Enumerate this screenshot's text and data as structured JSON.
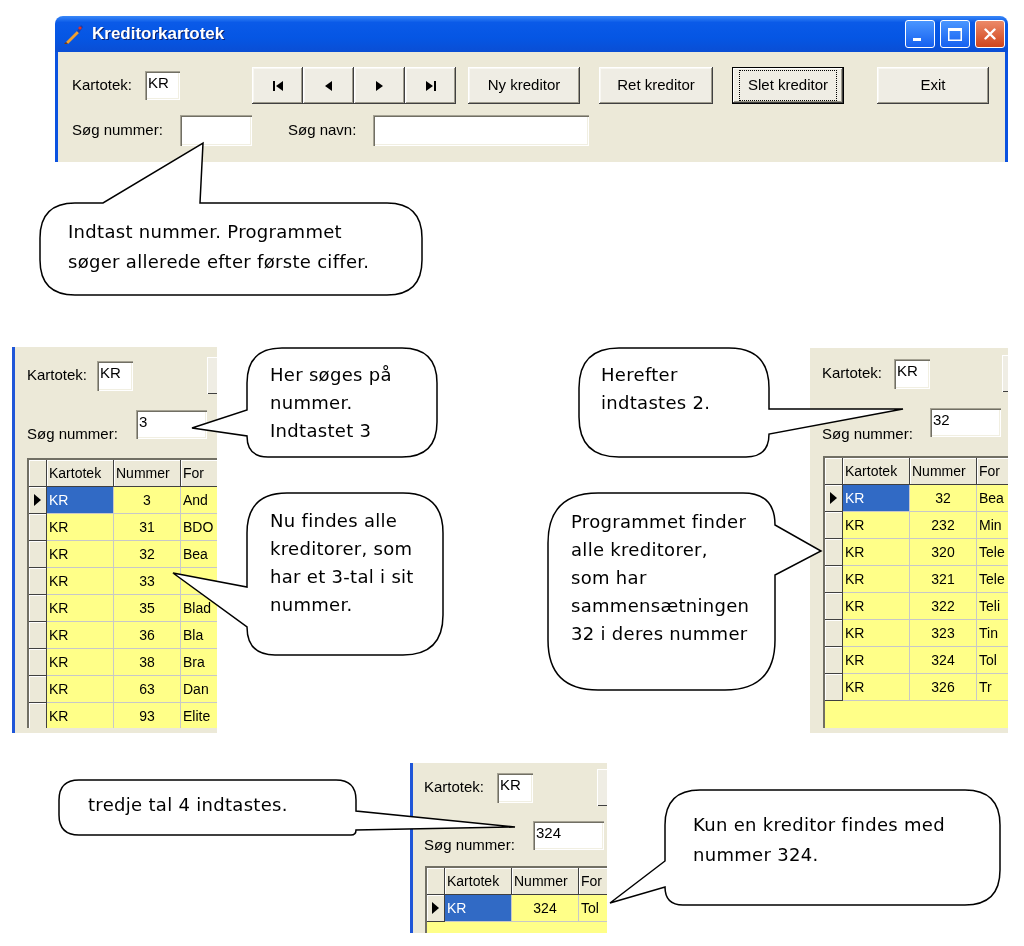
{
  "window": {
    "title": "Kreditorkartotek",
    "kartotek_label": "Kartotek:",
    "kartotek_value": "KR",
    "nav_buttons": [
      {
        "kind": "first"
      },
      {
        "kind": "previous"
      },
      {
        "kind": "next"
      },
      {
        "kind": "last"
      }
    ],
    "buttons": [
      {
        "label": "Ny kreditor",
        "focused": false
      },
      {
        "label": "Ret kreditor",
        "focused": false
      },
      {
        "label": "Slet kreditor",
        "focused": true
      },
      {
        "label": "Exit",
        "focused": false
      }
    ],
    "search_number_label": "Søg nummer:",
    "search_name_label": "Søg navn:"
  },
  "panels": [
    {
      "kartotek_label": "Kartotek:",
      "kartotek_value": "KR",
      "search_label": "Søg nummer:",
      "search_value": "3",
      "columns": [
        "Kartotek",
        "Nummer",
        "For"
      ],
      "rows": [
        {
          "kartotek": "KR",
          "number": "3",
          "name": "And",
          "selected": true
        },
        {
          "kartotek": "KR",
          "number": "31",
          "name": "BDO",
          "selected": false
        },
        {
          "kartotek": "KR",
          "number": "32",
          "name": "Bea",
          "selected": false
        },
        {
          "kartotek": "KR",
          "number": "33",
          "selected": false
        },
        {
          "kartotek": "KR",
          "number": "35",
          "name": "Blad",
          "selected": false
        },
        {
          "kartotek": "KR",
          "number": "36",
          "name": "Bla",
          "selected": false
        },
        {
          "kartotek": "KR",
          "number": "38",
          "name": "Bra",
          "selected": false
        },
        {
          "kartotek": "KR",
          "number": "63",
          "name": "Dan",
          "selected": false
        },
        {
          "kartotek": "KR",
          "number": "93",
          "name": "Elite",
          "selected": false
        }
      ]
    },
    {
      "kartotek_label": "Kartotek:",
      "kartotek_value": "KR",
      "search_label": "Søg nummer:",
      "search_value": "32",
      "columns": [
        "Kartotek",
        "Nummer",
        "For"
      ],
      "rows": [
        {
          "kartotek": "KR",
          "number": "32",
          "name": "Bea",
          "selected": true
        },
        {
          "kartotek": "KR",
          "number": "232",
          "name": "Min",
          "selected": false
        },
        {
          "kartotek": "KR",
          "number": "320",
          "name": "Tele",
          "selected": false
        },
        {
          "kartotek": "KR",
          "number": "321",
          "name": "Tele",
          "selected": false
        },
        {
          "kartotek": "KR",
          "number": "322",
          "name": "Teli",
          "selected": false
        },
        {
          "kartotek": "KR",
          "number": "323",
          "name": "Tin",
          "selected": false
        },
        {
          "kartotek": "KR",
          "number": "324",
          "name": "Tol",
          "selected": false
        },
        {
          "kartotek": "KR",
          "number": "326",
          "name": "Tr",
          "selected": false
        }
      ]
    },
    {
      "kartotek_label": "Kartotek:",
      "kartotek_value": "KR",
      "search_label": "Søg nummer:",
      "search_value": "324",
      "columns": [
        "Kartotek",
        "Nummer",
        "For"
      ],
      "rows": [
        {
          "kartotek": "KR",
          "number": "324",
          "name": "Tol",
          "selected": true
        }
      ]
    }
  ],
  "callouts": [
    {
      "text": "Indtast nummer. Programmet\nsøger allerede efter første ciffer."
    },
    {
      "text": "Her søges på\nnummer.\nIndtastet 3"
    },
    {
      "text": "Nu findes alle\nkreditorer, som\nhar et 3-tal i sit\nnummer."
    },
    {
      "text": "Herefter\nindtastes 2."
    },
    {
      "text": "Programmet finder\nalle kreditorer,\nsom har\nsammensætningen\n32 i deres nummer"
    },
    {
      "text": "tredje tal 4 indtastes."
    },
    {
      "text": "Kun en kreditor findes med\nnummer 324."
    }
  ]
}
